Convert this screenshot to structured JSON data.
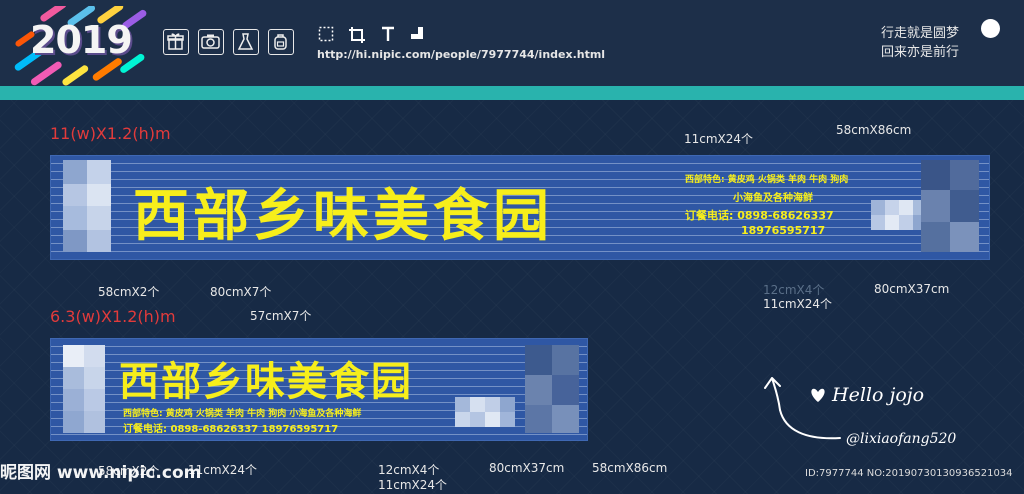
{
  "header": {
    "year": "2019",
    "url": "http://hi.nipic.com/people/7977744/index.html",
    "slogan_line1": "行走就是圆梦",
    "slogan_line2": "回来亦是前行",
    "tools": [
      "gift-icon",
      "camera-icon",
      "dress-icon",
      "backpack-icon"
    ],
    "tools2": [
      "select-icon",
      "crop-icon",
      "text-icon",
      "corner-icon"
    ]
  },
  "banner_large": {
    "size_label": "11(w)X1.2(h)m",
    "title": "西部乡味美食园",
    "specialty": "西部特色: 黄皮鸡  火锅类  羊肉  牛肉  狗肉",
    "specialty2": "小海鱼及各种海鲜",
    "phone": "订餐电话: 0898-68626337",
    "mobile": "18976595717"
  },
  "banner_small": {
    "size_label": "6.3(w)X1.2(h)m",
    "title": "西部乡味美食园",
    "specialty": "西部特色: 黄皮鸡  火锅类  羊肉  牛肉  狗肉  小海鱼及各种海鲜",
    "phone": "订餐电话: 0898-68626337    18976595717"
  },
  "dimensions": {
    "top_11x24": "11cmX24个",
    "top_58x86": "58cmX86cm",
    "l1_58x2": "58cmX2个",
    "l1_80x7": "80cmX7个",
    "l1_12x4": "12cmX4个",
    "l1_11x24": "11cmX24个",
    "l1_80x37": "80cmX37cm",
    "mid_57x7": "57cmX7个",
    "b_58x2": "58cmX2个",
    "b_11x24": "11cmX24个",
    "b_12x4": "12cmX4个",
    "b_11x24b": "11cmX24个",
    "b_80x37": "80cmX37cm",
    "b_58x86": "58cmX86cm"
  },
  "signature": {
    "hello": "Hello jojo",
    "handle": "@lixiaofang520"
  },
  "footer": {
    "watermark": "昵图网 www.nipic.com",
    "id": "ID:7977744 NO:20190730130936521034"
  },
  "colors": {
    "banner_blue": "#2f57a4",
    "title_yellow": "#f7ee1b",
    "teal": "#29b3ad",
    "size_red": "#e23b3b"
  }
}
